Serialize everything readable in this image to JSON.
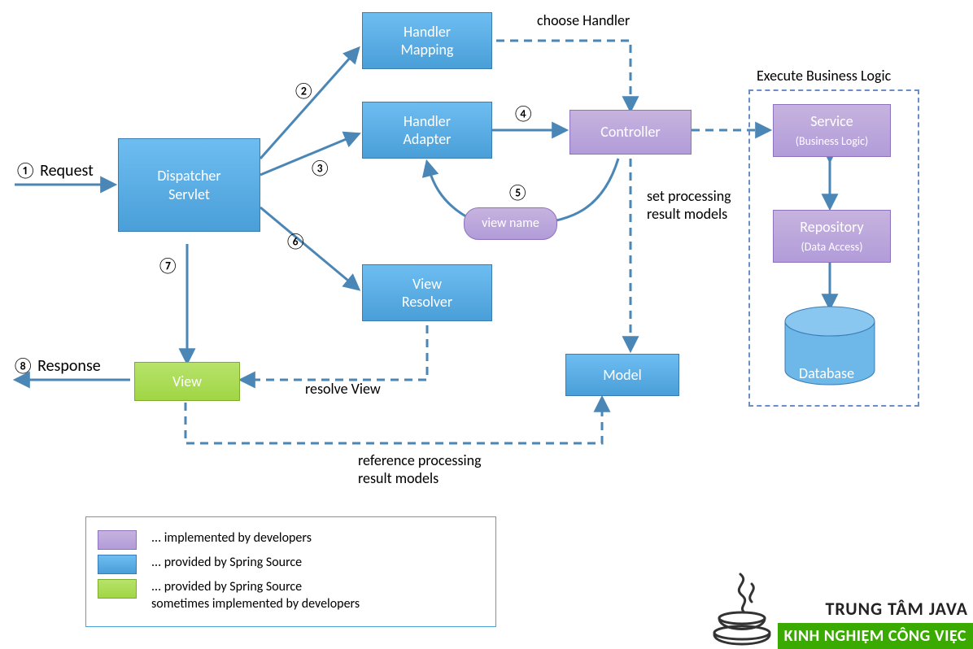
{
  "steps": {
    "s1": "①",
    "s2": "②",
    "s3": "③",
    "s4": "④",
    "s5": "⑤",
    "s6": "⑥",
    "s7": "⑦",
    "s8": "⑧"
  },
  "labels": {
    "request": "Request",
    "response": "Response",
    "choose_handler": "choose Handler",
    "exec_biz": "Execute Business Logic",
    "set_models_l1": "set processing",
    "set_models_l2": "result models",
    "resolve_view": "resolve View",
    "ref_models_l1": "reference processing",
    "ref_models_l2": "result models"
  },
  "boxes": {
    "dispatcher_l1": "Dispatcher",
    "dispatcher_l2": "Servlet",
    "handler_mapping_l1": "Handler",
    "handler_mapping_l2": "Mapping",
    "handler_adapter_l1": "Handler",
    "handler_adapter_l2": "Adapter",
    "controller": "Controller",
    "view_name": "view name",
    "view_resolver_l1": "View",
    "view_resolver_l2": "Resolver",
    "view": "View",
    "model": "Model",
    "service_l1": "Service",
    "service_l2": "(Business Logic)",
    "repository_l1": "Repository",
    "repository_l2": "(Data Access)",
    "database": "Database"
  },
  "legend": {
    "dev": "... implemented by developers",
    "spring": "... provided by Spring Source",
    "mixed_l1": "... provided by Spring Source",
    "mixed_l2": "sometimes implemented by developers"
  },
  "logo": {
    "line1": "TRUNG TÂM JAVA",
    "line2": "KINH NGHIỆM CÔNG VIỆC"
  }
}
